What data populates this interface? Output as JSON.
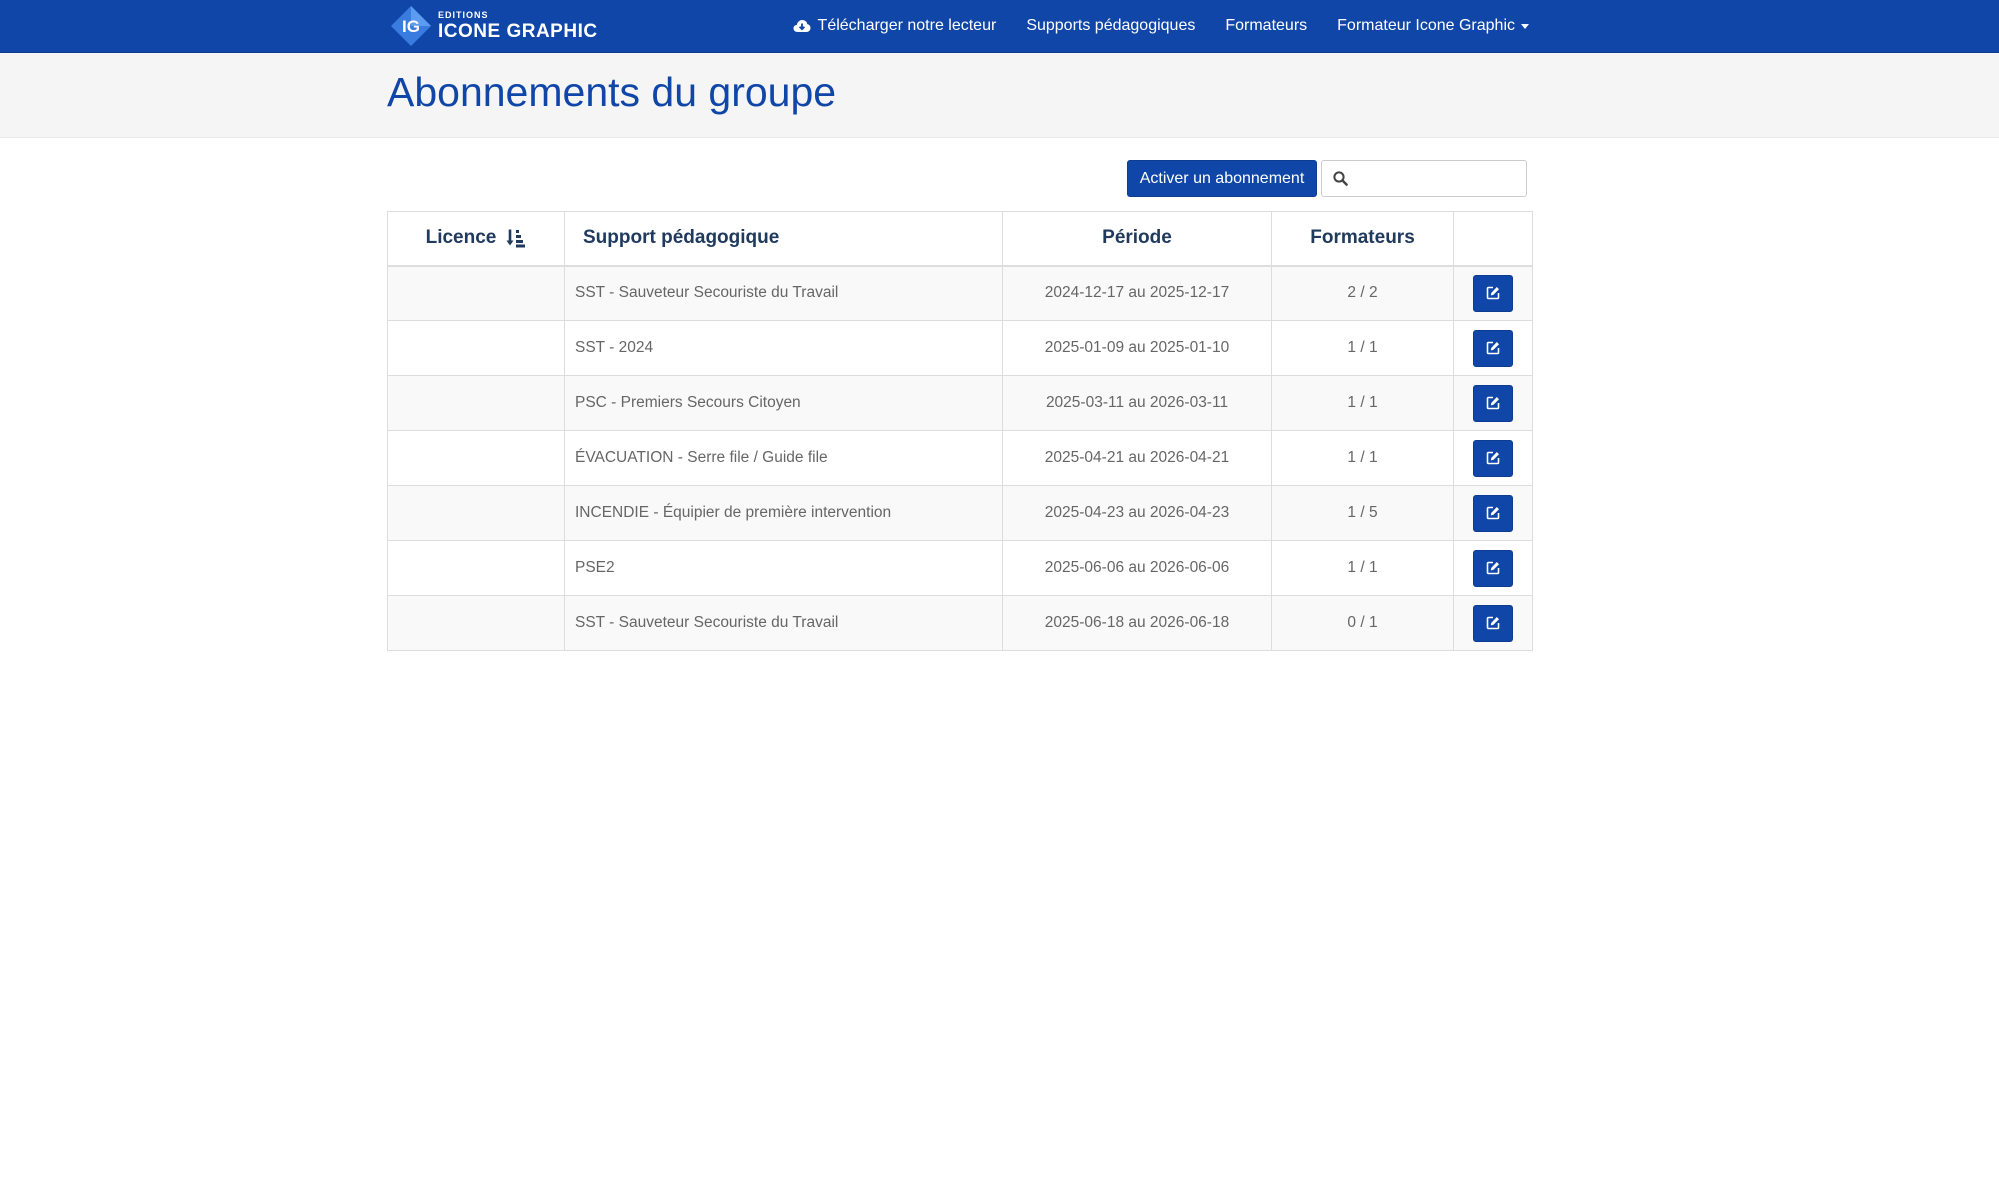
{
  "brand": {
    "badge_text": "IG",
    "small_text": "EDITIONS",
    "name": "ICONE GRAPHIC"
  },
  "nav": {
    "items": [
      {
        "label": "Télécharger notre lecteur",
        "icon": "cloud-download-icon"
      },
      {
        "label": "Supports pédagogiques"
      },
      {
        "label": "Formateurs"
      },
      {
        "label": "Formateur Icone Graphic",
        "dropdown": true
      }
    ]
  },
  "page": {
    "title": "Abonnements du groupe"
  },
  "toolbar": {
    "activate_label": "Activer un abonnement",
    "search_value": "",
    "search_icon": "search-icon"
  },
  "table": {
    "headers": {
      "licence": "Licence",
      "support": "Support pédagogique",
      "periode": "Période",
      "formateurs": "Formateurs",
      "actions": ""
    },
    "sort_icon": "sort-amount-asc-icon",
    "edit_icon": "edit-icon",
    "rows": [
      {
        "licence": "",
        "support": "SST - Sauveteur Secouriste du Travail",
        "periode": "2024-12-17 au 2025-12-17",
        "formateurs": "2 / 2"
      },
      {
        "licence": "",
        "support": "SST - 2024",
        "periode": "2025-01-09 au 2025-01-10",
        "formateurs": "1 / 1"
      },
      {
        "licence": "",
        "support": "PSC - Premiers Secours Citoyen",
        "periode": "2025-03-11 au 2026-03-11",
        "formateurs": "1 / 1"
      },
      {
        "licence": "",
        "support": "ÉVACUATION - Serre file / Guide file",
        "periode": "2025-04-21 au 2026-04-21",
        "formateurs": "1 / 1"
      },
      {
        "licence": "",
        "support": "INCENDIE - Équipier de première intervention",
        "periode": "2025-04-23 au 2026-04-23",
        "formateurs": "1 / 5"
      },
      {
        "licence": "",
        "support": "PSE2",
        "periode": "2025-06-06 au 2026-06-06",
        "formateurs": "1 / 1"
      },
      {
        "licence": "",
        "support": "SST - Sauveteur Secouriste du Travail",
        "periode": "2025-06-18 au 2026-06-18",
        "formateurs": "0 / 1"
      }
    ]
  },
  "colors": {
    "brand_blue": "#1046a8",
    "header_text": "#203a5e",
    "cell_text": "#666666"
  }
}
